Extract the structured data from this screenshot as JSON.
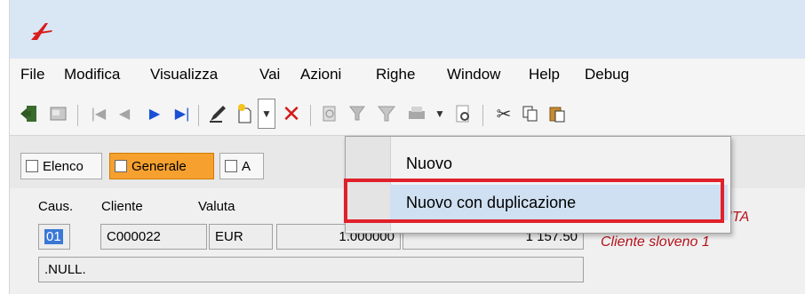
{
  "menu": {
    "items": [
      "File",
      "Modifica",
      "Visualizza",
      "Vai",
      "Azioni",
      "Righe",
      "Window",
      "Help",
      "Debug"
    ]
  },
  "toolbar": {
    "icons": [
      "exit-icon",
      "properties-icon",
      "first-record-icon",
      "previous-record-icon",
      "next-record-icon",
      "last-record-icon",
      "edit-icon",
      "new-icon",
      "new-dropdown-arrow-icon",
      "delete-icon",
      "refresh-icon",
      "filter-icon",
      "funnel-icon",
      "print-icon",
      "print-dropdown-arrow-icon",
      "preview-icon",
      "cut-icon",
      "copy-icon",
      "paste-icon"
    ]
  },
  "views": {
    "elenco": "Elenco",
    "generale": "Generale",
    "partial": "A"
  },
  "form": {
    "labels": {
      "causale": "Caus.",
      "cliente": "Cliente",
      "valuta": "Valuta"
    },
    "values": {
      "causale": "01",
      "cliente": "C000022",
      "valuta": "EUR",
      "cambio": "1.000000",
      "importo": "1 157.50",
      "note": ".NULL."
    },
    "status_partial": "DITA",
    "cliente_nome": "Cliente sloveno 1"
  },
  "dropdown": {
    "items": [
      "Nuovo",
      "Nuovo con duplicazione"
    ]
  },
  "colors": {
    "accent_orange": "#f6a12f",
    "highlight_red": "#e0202a",
    "text_red": "#b5121b",
    "selection_blue": "#3a78d6"
  }
}
